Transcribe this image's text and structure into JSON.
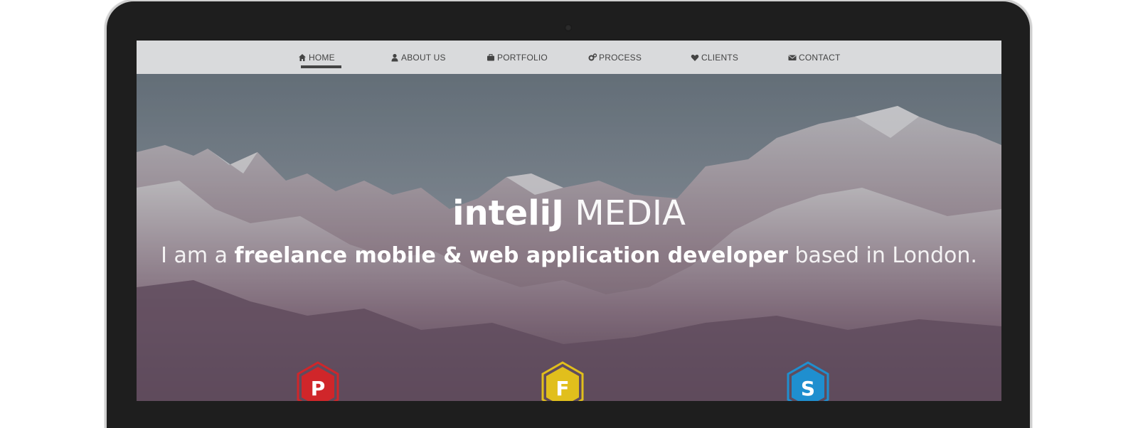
{
  "nav": {
    "items": [
      {
        "label": "HOME",
        "icon": "home-icon"
      },
      {
        "label": "ABOUT US",
        "icon": "user-icon"
      },
      {
        "label": "PORTFOLIO",
        "icon": "briefcase-icon"
      },
      {
        "label": "PROCESS",
        "icon": "gears-icon"
      },
      {
        "label": "CLIENTS",
        "icon": "heart-icon"
      },
      {
        "label": "CONTACT",
        "icon": "envelope-icon"
      }
    ],
    "active": "HOME"
  },
  "hero": {
    "title_strong": "inteliJ",
    "title_light": "MEDIA",
    "subtitle_pre": "I am a",
    "subtitle_strong": "freelance mobile & web application developer",
    "subtitle_post": "based in London."
  },
  "badges": [
    {
      "letter": "P",
      "color": "#d0262a"
    },
    {
      "letter": "F",
      "color": "#e1bf1c"
    },
    {
      "letter": "S",
      "color": "#1f8fcf"
    }
  ],
  "colors": {
    "device": "#1e1e1e",
    "navbar": "#d9dadc",
    "nav_text": "#444444"
  }
}
